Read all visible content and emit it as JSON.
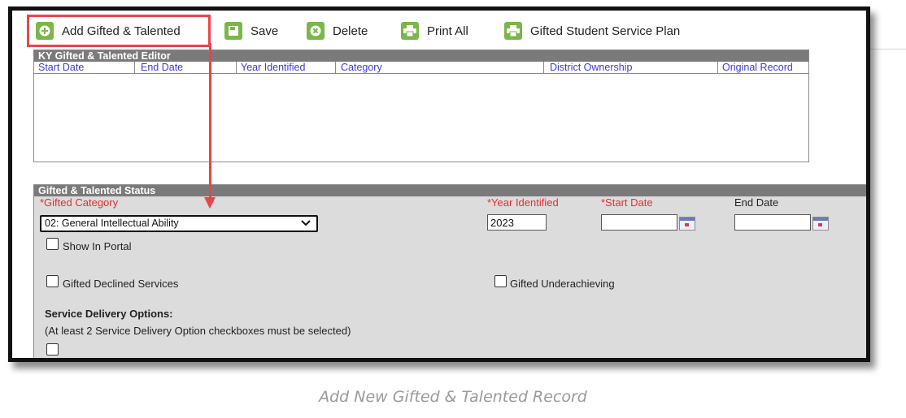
{
  "toolbar": {
    "add_label": "Add Gifted & Talented",
    "save_label": "Save",
    "delete_label": "Delete",
    "print_all_label": "Print All",
    "service_plan_label": "Gifted Student Service Plan"
  },
  "editor": {
    "title": "KY Gifted & Talented Editor",
    "columns": [
      "Start Date",
      "End Date",
      "Year Identified",
      "Category",
      "District Ownership",
      "Original Record"
    ]
  },
  "status": {
    "title": "Gifted & Talented Status",
    "gifted_category_label": "*Gifted Category",
    "gifted_category_value": "02: General Intellectual Ability",
    "year_identified_label": "*Year Identified",
    "year_identified_value": "2023",
    "start_date_label": "*Start Date",
    "end_date_label": "End Date",
    "show_in_portal_label": "Show In Portal",
    "declined_services_label": "Gifted Declined Services",
    "underachieving_label": "Gifted Underachieving",
    "service_delivery_heading": "Service Delivery Options:",
    "service_delivery_note": "(At least 2 Service Delivery Option checkboxes must be selected)"
  },
  "caption": "Add New Gifted & Talented Record",
  "colors": {
    "accent_green": "#7ab648",
    "highlight_red": "#e8454a",
    "required_red": "#e03030",
    "header_link_blue": "#3b3bdc"
  }
}
